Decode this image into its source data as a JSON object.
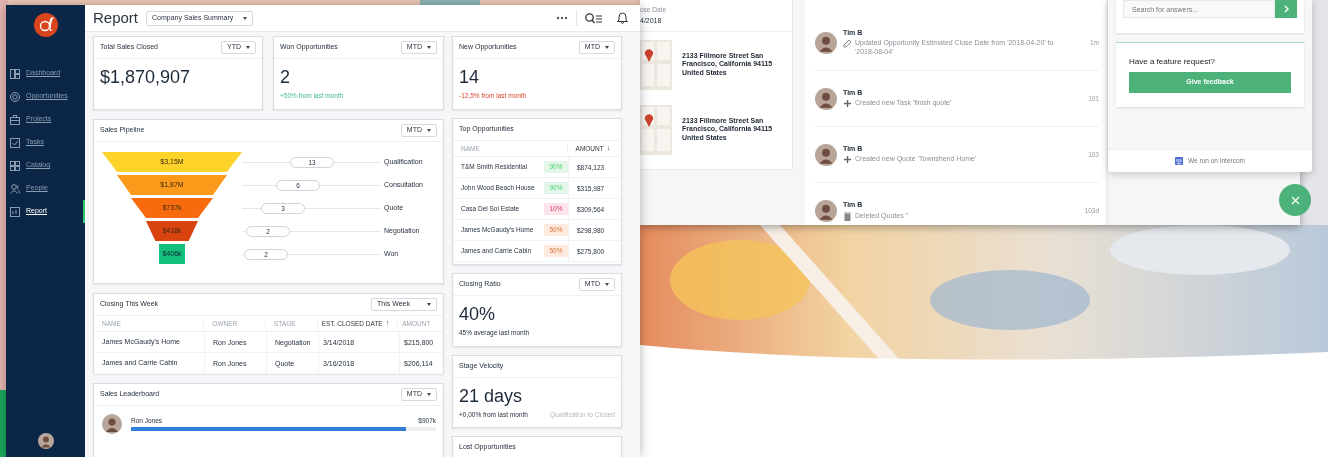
{
  "sidebar": {
    "items": [
      {
        "label": "Dashboard",
        "selected": false
      },
      {
        "label": "Opportunities",
        "selected": false
      },
      {
        "label": "Projects",
        "selected": false
      },
      {
        "label": "Tasks",
        "selected": false
      },
      {
        "label": "Catalog",
        "selected": false
      },
      {
        "label": "People",
        "selected": false
      },
      {
        "label": "Report",
        "selected": true
      }
    ]
  },
  "header": {
    "title": "Report",
    "report_select": "Company Sales Summary"
  },
  "total_sales": {
    "title": "Total Sales Closed",
    "period": "YTD",
    "value": "$1,870,907"
  },
  "won_opportunities": {
    "title": "Won Opportunities",
    "period": "MTD",
    "value": "2",
    "change": "+50% from last month",
    "positive": true
  },
  "new_opportunities": {
    "title": "New Opportunities",
    "period": "MTD",
    "value": "14",
    "change": "-12,5% from last month",
    "negative": true
  },
  "sales_pipeline": {
    "title": "Sales Pipeline",
    "period": "MTD",
    "stages": [
      {
        "value": "$3,15M",
        "count": "13",
        "name": "Qualification",
        "color": "#fdd329",
        "kind": "trapezoid"
      },
      {
        "value": "$1,87M",
        "count": "6",
        "name": "Consultation",
        "color": "#fb9a1a",
        "kind": "trapezoid"
      },
      {
        "value": "$737k",
        "count": "3",
        "name": "Quote",
        "color": "#f86a0e",
        "kind": "trapezoid"
      },
      {
        "value": "$418k",
        "count": "2",
        "name": "Negotiation",
        "color": "#d8430f",
        "kind": "trapezoid"
      },
      {
        "value": "$406k",
        "count": "2",
        "name": "Won",
        "color": "#14c07c",
        "kind": "block"
      }
    ]
  },
  "top_opportunities": {
    "title": "Top Opportunities",
    "columns": [
      {
        "label": "NAME"
      },
      {
        "label": "AMOUNT",
        "sort_arrow": "↓"
      }
    ],
    "rows": [
      {
        "name": "T&M Smith Residential",
        "probability": "90%",
        "color": "#e3f6e9",
        "amount": "$874,123"
      },
      {
        "name": "John Wood Beach House",
        "probability": "90%",
        "color": "#e3f6e9",
        "amount": "$315,987"
      },
      {
        "name": "Casa Del Sol Estate",
        "probability": "10%",
        "color": "#fde3ea",
        "amount": "$309,564"
      },
      {
        "name": "James McGaudy's Home",
        "probability": "50%",
        "color": "#fdeadf",
        "amount": "$298,980"
      },
      {
        "name": "James and Carrie Cabin",
        "probability": "50%",
        "color": "#fdeadf",
        "amount": "$275,800"
      }
    ]
  },
  "closing_this_week": {
    "title": "Closing This Week",
    "period": "This Week",
    "columns": [
      {
        "label": "NAME"
      },
      {
        "label": "OWNER"
      },
      {
        "label": "STAGE"
      },
      {
        "label": "EST. CLOSED DATE",
        "sort_arrow": "↑"
      },
      {
        "label": "AMOUNT"
      }
    ],
    "rows": [
      [
        "James McGaudy's Home",
        "Ron Jones",
        "Negotiation",
        "3/14/2018",
        "$215,800"
      ],
      [
        "James and Carrie Cabin",
        "Ron Jones",
        "Quote",
        "3/16/2018",
        "$206,114"
      ]
    ]
  },
  "closing_ratio": {
    "title": "Closing Ratio",
    "period": "MTD",
    "value": "40%",
    "change": "45% average last month",
    "positive": false,
    "negative": false
  },
  "stage_velocity": {
    "title": "Stage Velocity",
    "value": "21 days",
    "change": "+0,00% from last month",
    "positive": false,
    "negative": false,
    "note": "Qualification to Closed"
  },
  "sales_leaderboard": {
    "title": "Sales Leaderboard",
    "period": "MTD",
    "entries": [
      {
        "name": "Ron Jones",
        "amount": "$907k",
        "level": 0.9
      }
    ]
  },
  "lost_opportunities": {
    "title": "Lost Opportunities"
  },
  "background_window": {
    "close_date_label": "ose Date",
    "close_date": "4/2018",
    "addresses": [
      "2133 Fillmore Street San Francisco, California 94115 United States",
      "2133 Fillmore Street San Francisco, California 94115 United States"
    ],
    "activity": [
      {
        "name": "Tim B",
        "kind": "edit",
        "text": "Updated Opportunity Estimated Close Date from '2018-04-20' to '2018-08-04'",
        "time": "1m"
      },
      {
        "name": "Tim B",
        "kind": "create",
        "text": "Created new Task 'finish quote'",
        "time": "101"
      },
      {
        "name": "Tim B",
        "kind": "create",
        "text": "Created new Quote 'Townshend Home'",
        "time": "103"
      },
      {
        "name": "Tim B",
        "kind": "delete",
        "text": "Deleted Quotes ''",
        "time": "103d"
      }
    ]
  },
  "intercom": {
    "search_placeholder": "Search for answers...",
    "feature_title": "Have a feature request?",
    "feedback_button": "Give feedback",
    "footer": "We run on Intercom"
  }
}
